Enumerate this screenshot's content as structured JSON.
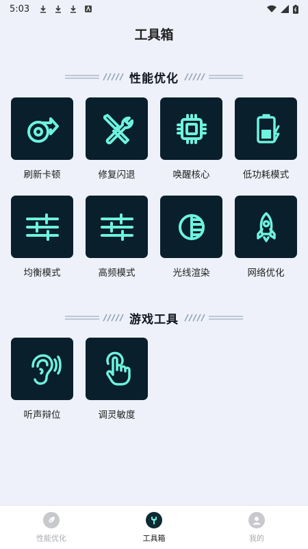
{
  "status_bar": {
    "time": "5:03"
  },
  "page_title": "工具箱",
  "sections": [
    {
      "title": "性能优化",
      "tools": [
        {
          "label": "刷新卡顿",
          "icon": "turbo-icon"
        },
        {
          "label": "修复闪退",
          "icon": "tools-icon"
        },
        {
          "label": "唤醒核心",
          "icon": "cpu-chip-icon"
        },
        {
          "label": "低功耗模式",
          "icon": "battery-charging-icon"
        },
        {
          "label": "均衡模式",
          "icon": "sliders-icon"
        },
        {
          "label": "高频模式",
          "icon": "sliders-icon"
        },
        {
          "label": "光线渲染",
          "icon": "lens-shading-icon"
        },
        {
          "label": "网络优化",
          "icon": "rocket-icon"
        }
      ]
    },
    {
      "title": "游戏工具",
      "tools": [
        {
          "label": "听声辩位",
          "icon": "ear-icon"
        },
        {
          "label": "调灵敏度",
          "icon": "touch-hand-icon"
        }
      ]
    }
  ],
  "bottom_nav": [
    {
      "label": "性能优化",
      "icon": "leaf-icon",
      "active": false
    },
    {
      "label": "工具箱",
      "icon": "wrench-icon",
      "active": true
    },
    {
      "label": "我的",
      "icon": "user-icon",
      "active": false
    }
  ],
  "colors": {
    "tile_bg": "#0a1f2c",
    "icon_accent": "#6ef3e0",
    "page_bg": "#eef1f9"
  }
}
